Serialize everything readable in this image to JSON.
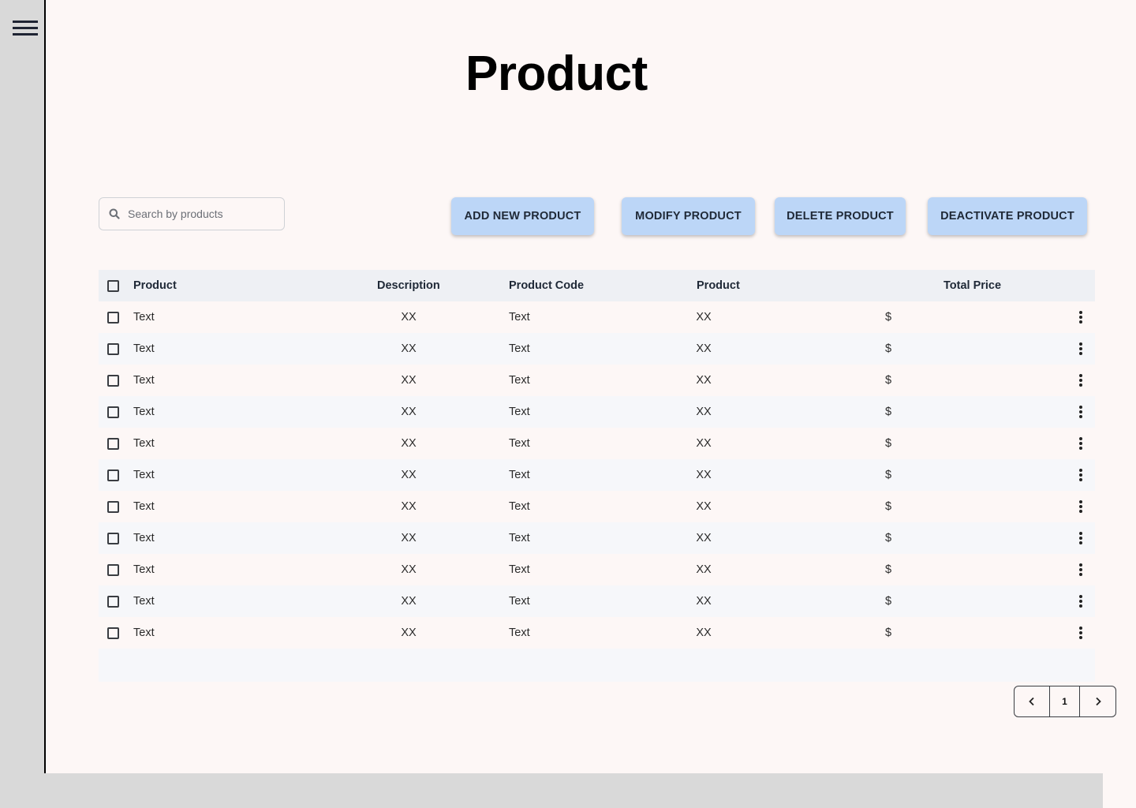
{
  "sidebar": {
    "menu_icon": "hamburger-menu-icon"
  },
  "page": {
    "title": "Product"
  },
  "search": {
    "placeholder": "Search by products",
    "value": "",
    "icon": "search-icon"
  },
  "toolbar": {
    "add_label": "ADD NEW PRODUCT",
    "modify_label": "MODIFY PRODUCT",
    "delete_label": "DELETE PRODUCT",
    "deactivate_label": "DEACTIVATE PRODUCT"
  },
  "colors": {
    "button_bg": "#bcd6f7",
    "page_bg": "#fdf7f6",
    "sidebar_bg": "#d9d9d9",
    "header_row_bg": "#eef0f4"
  },
  "table": {
    "columns": [
      "Product",
      "Description",
      "Product Code",
      "Product",
      "Total Price"
    ],
    "rows": [
      [
        "Text",
        "XX",
        "Text",
        "XX",
        "$"
      ],
      [
        "Text",
        "XX",
        "Text",
        "XX",
        "$"
      ],
      [
        "Text",
        "XX",
        "Text",
        "XX",
        "$"
      ],
      [
        "Text",
        "XX",
        "Text",
        "XX",
        "$"
      ],
      [
        "Text",
        "XX",
        "Text",
        "XX",
        "$"
      ],
      [
        "Text",
        "XX",
        "Text",
        "XX",
        "$"
      ],
      [
        "Text",
        "XX",
        "Text",
        "XX",
        "$"
      ],
      [
        "Text",
        "XX",
        "Text",
        "XX",
        "$"
      ],
      [
        "Text",
        "XX",
        "Text",
        "XX",
        "$"
      ],
      [
        "Text",
        "XX",
        "Text",
        "XX",
        "$"
      ],
      [
        "Text",
        "XX",
        "Text",
        "XX",
        "$"
      ]
    ],
    "row_action_icon": "kebab-menu-icon"
  },
  "pagination": {
    "current_page": "1",
    "prev_icon": "chevron-left-icon",
    "next_icon": "chevron-right-icon"
  }
}
